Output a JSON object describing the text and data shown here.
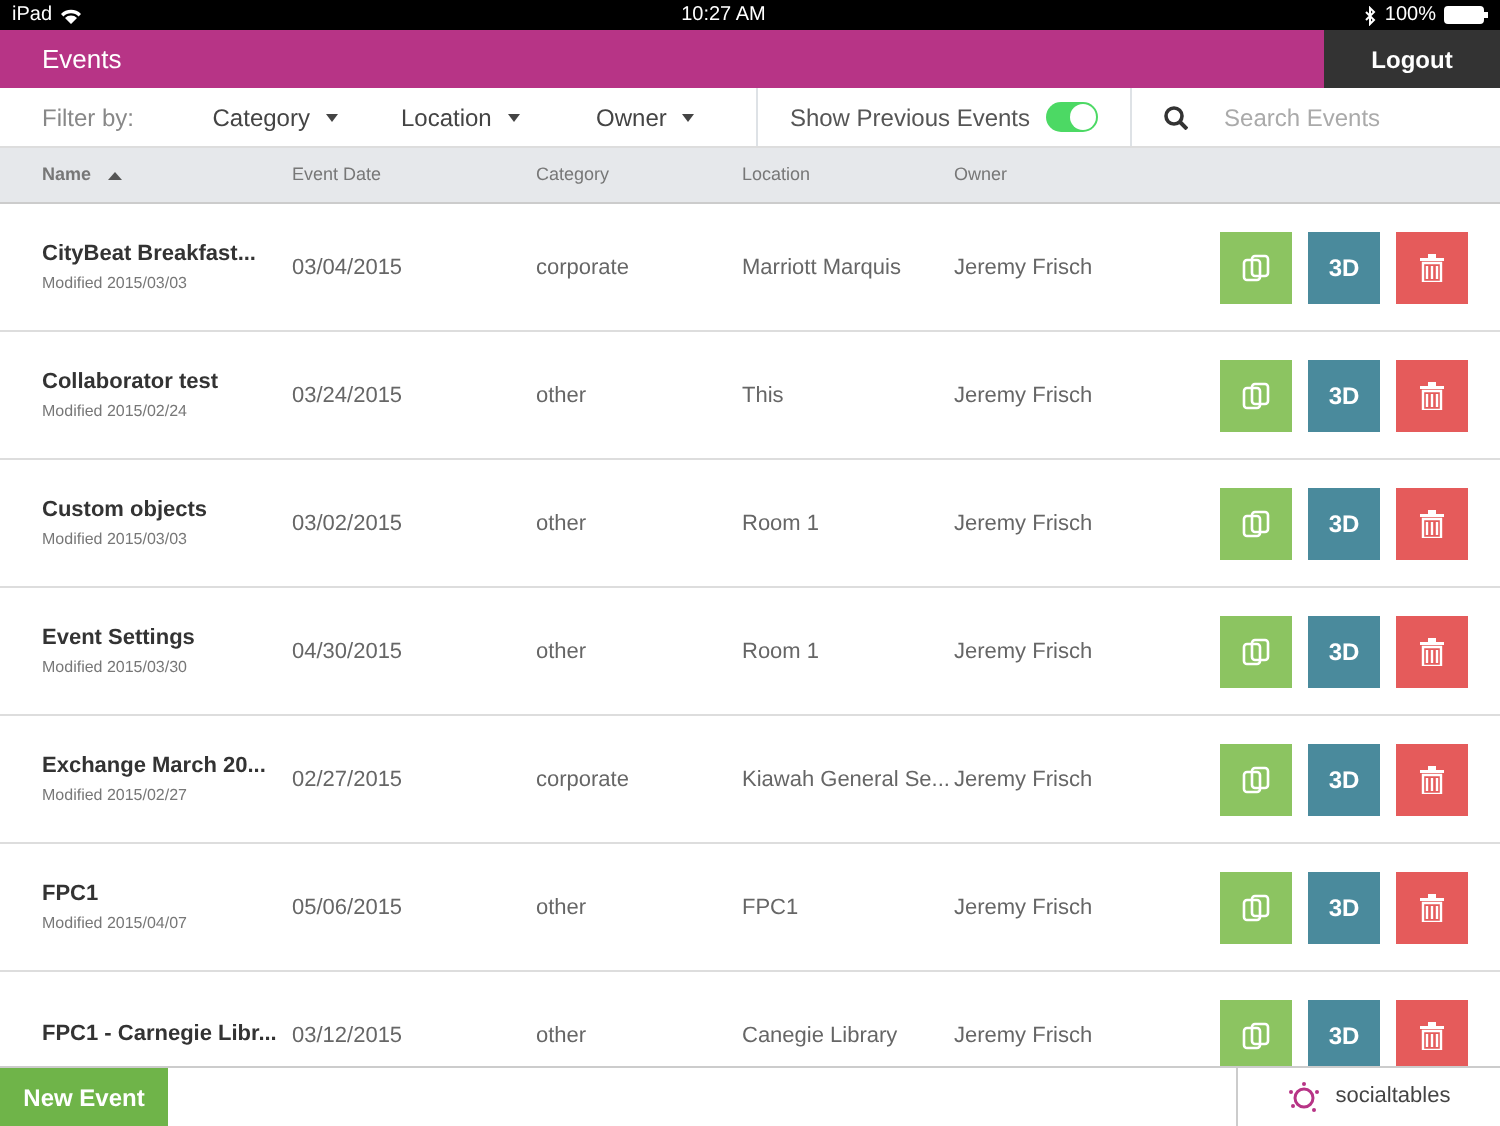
{
  "status_bar": {
    "device": "iPad",
    "time": "10:27 AM",
    "battery": "100%"
  },
  "header": {
    "title": "Events",
    "logout": "Logout"
  },
  "filters": {
    "label": "Filter by:",
    "dropdowns": [
      "Category",
      "Location",
      "Owner"
    ],
    "show_previous": {
      "label": "Show Previous Events",
      "on": true
    },
    "search": {
      "placeholder": "Search Events"
    }
  },
  "table": {
    "columns": [
      {
        "label": "Name",
        "sorted": true
      },
      {
        "label": "Event Date",
        "sorted": false
      },
      {
        "label": "Category",
        "sorted": false
      },
      {
        "label": "Location",
        "sorted": false
      },
      {
        "label": "Owner",
        "sorted": false
      }
    ],
    "rows": [
      {
        "name": "CityBeat Breakfast...",
        "modified": "Modified 2015/03/03",
        "date": "03/04/2015",
        "category": "corporate",
        "location": "Marriott Marquis",
        "owner": "Jeremy Frisch",
        "action_3d": "3D"
      },
      {
        "name": "Collaborator test",
        "modified": "Modified 2015/02/24",
        "date": "03/24/2015",
        "category": "other",
        "location": "This",
        "owner": "Jeremy Frisch",
        "action_3d": "3D"
      },
      {
        "name": "Custom objects",
        "modified": "Modified 2015/03/03",
        "date": "03/02/2015",
        "category": "other",
        "location": "Room 1",
        "owner": "Jeremy Frisch",
        "action_3d": "3D"
      },
      {
        "name": "Event Settings",
        "modified": "Modified 2015/03/30",
        "date": "04/30/2015",
        "category": "other",
        "location": "Room 1",
        "owner": "Jeremy Frisch",
        "action_3d": "3D"
      },
      {
        "name": "Exchange March 20...",
        "modified": "Modified 2015/02/27",
        "date": "02/27/2015",
        "category": "corporate",
        "location": "Kiawah General Se...",
        "owner": "Jeremy Frisch",
        "action_3d": "3D"
      },
      {
        "name": "FPC1",
        "modified": "Modified 2015/04/07",
        "date": "05/06/2015",
        "category": "other",
        "location": "FPC1",
        "owner": "Jeremy Frisch",
        "action_3d": "3D"
      },
      {
        "name": "FPC1 - Carnegie Libr...",
        "date": "03/12/2015",
        "category": "other",
        "location": "Canegie Library",
        "owner": "Jeremy Frisch",
        "action_3d": "3D"
      }
    ]
  },
  "footer": {
    "new_event": "New Event",
    "logo_text": "socialtables"
  }
}
